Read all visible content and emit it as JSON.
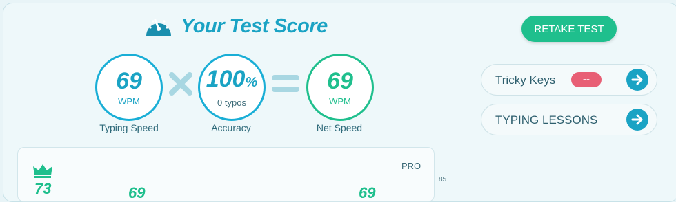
{
  "header": {
    "title": "Your Test Score"
  },
  "scores": {
    "speed": {
      "value": "69",
      "unit": "WPM",
      "caption": "Typing Speed"
    },
    "accuracy": {
      "value": "100",
      "percent": "%",
      "typos": "0 typos",
      "caption": "Accuracy"
    },
    "net": {
      "value": "69",
      "unit": "WPM",
      "caption": "Net Speed"
    }
  },
  "actions": {
    "retake_label": "RETAKE TEST"
  },
  "side_links": {
    "tricky": {
      "label": "Tricky Keys",
      "badge": "--"
    },
    "lessons": {
      "label": "TYPING LESSONS"
    }
  },
  "chart": {
    "pro_label": "PRO",
    "tick_85": "85",
    "best_value": "73",
    "point_left": "69",
    "point_right": "69"
  },
  "colors": {
    "accent_blue": "#1aa3c4",
    "accent_green": "#1fbf8d",
    "badge_red": "#e85f75"
  }
}
